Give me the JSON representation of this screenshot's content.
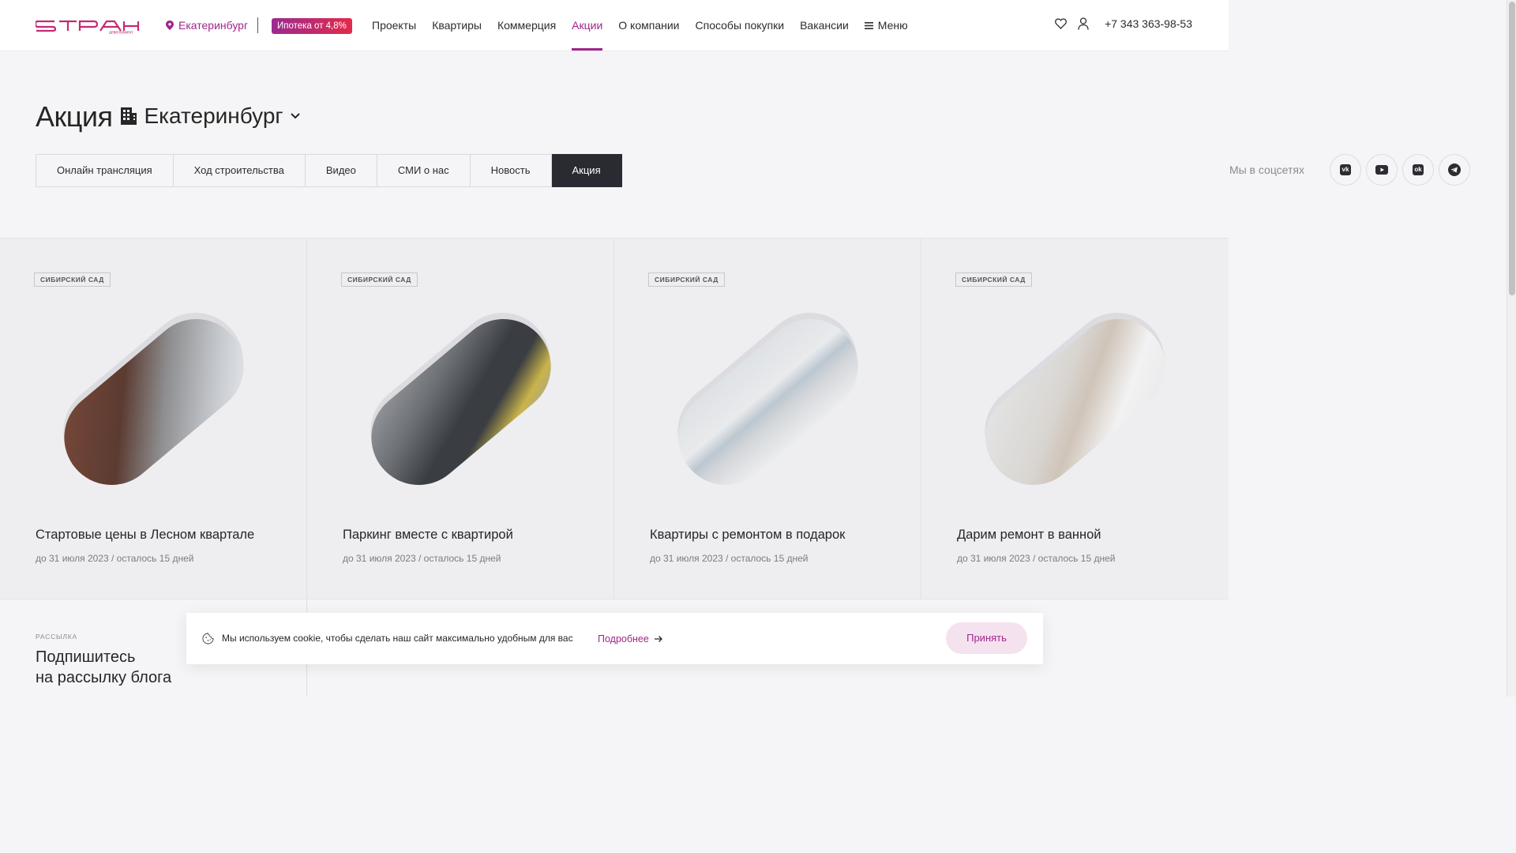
{
  "header": {
    "logo_alt": "СТРАНА девелопмент",
    "city": "Екатеринбург",
    "mortgage_badge": "Ипотека от 4,8%",
    "nav": [
      "Проекты",
      "Квартиры",
      "Коммерция",
      "Акции",
      "О компании",
      "Способы покупки",
      "Вакансии"
    ],
    "active_nav": "Акции",
    "menu_label": "Меню",
    "phone": "+7 343 363-98-53"
  },
  "page": {
    "title": "Акция",
    "city_select": "Екатеринбург"
  },
  "tabs": [
    "Онлайн трансляция",
    "Ход строительства",
    "Видео",
    "СМИ о нас",
    "Новость",
    "Акция"
  ],
  "active_tab": "Акция",
  "social": {
    "label": "Мы в соцсетях",
    "icons": [
      "vk-icon",
      "youtube-icon",
      "odnoklassniki-icon",
      "telegram-icon"
    ]
  },
  "cards": [
    {
      "tag": "СИБИРСКИЙ САД",
      "title": "Стартовые цены в Лесном квартале",
      "date": "до 31 июля 2023 / осталось 15 дней"
    },
    {
      "tag": "СИБИРСКИЙ САД",
      "title": "Паркинг вместе с квартирой",
      "date": "до 31 июля 2023 / осталось 15 дней"
    },
    {
      "tag": "СИБИРСКИЙ САД",
      "title": "Квартиры с ремонтом в подарок",
      "date": "до 31 июля 2023 / осталось 15 дней"
    },
    {
      "tag": "СИБИРСКИЙ САД",
      "title": "Дарим ремонт в ванной",
      "date": "до 31 июля 2023 / осталось 15 дней"
    }
  ],
  "newsletter": {
    "caption": "РАССЫЛКА",
    "heading_line1": "Подпишитесь",
    "heading_line2": "на рассылку блога"
  },
  "cookie": {
    "text": "Мы используем cookie, чтобы сделать наш сайт максимально удобным для вас",
    "more": "Подробнее",
    "accept": "Принять"
  },
  "colors": {
    "accent": "#a2258b",
    "dark": "#2a2a33"
  }
}
